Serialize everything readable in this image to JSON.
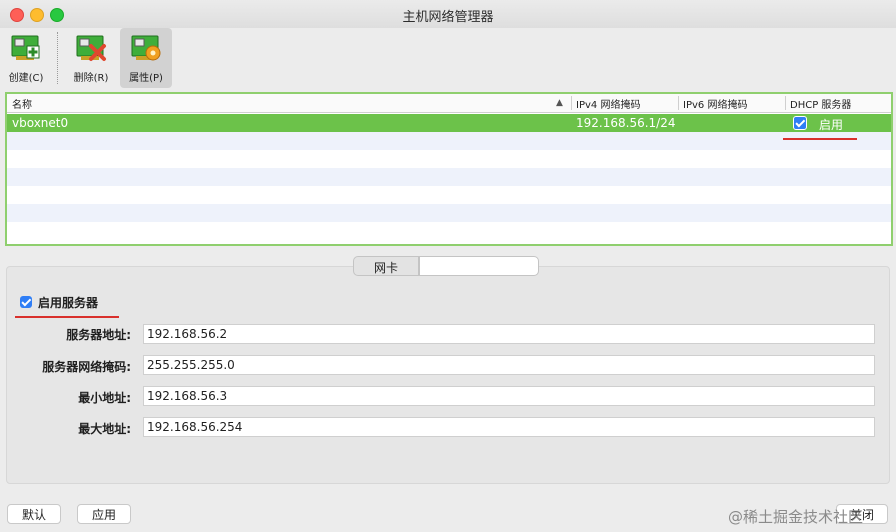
{
  "window": {
    "title": "主机网络管理器"
  },
  "toolbar": {
    "create_label": "创建(C)",
    "delete_label": "删除(R)",
    "properties_label": "属性(P)"
  },
  "table": {
    "columns": [
      "名称",
      "IPv4 网络掩码",
      "IPv6 网络掩码",
      "DHCP 服务器"
    ],
    "rows": [
      {
        "name": "vboxnet0",
        "ipv4": "192.168.56.1/24",
        "ipv6": "",
        "dhcp_label": "启用",
        "dhcp_checked": true
      }
    ]
  },
  "tabs": {
    "adapter_label": "网卡",
    "dhcp_label": ""
  },
  "dhcp": {
    "enable_label": "启用服务器",
    "enable_checked": true,
    "server_address_label": "服务器地址:",
    "server_address": "192.168.56.2",
    "server_mask_label": "服务器网络掩码:",
    "server_mask": "255.255.255.0",
    "lower_label": "最小地址:",
    "lower": "192.168.56.3",
    "upper_label": "最大地址:",
    "upper": "192.168.56.254"
  },
  "buttons": {
    "reset": "默认",
    "apply": "应用",
    "close": "关闭"
  },
  "watermark": "@稀土掘金技术社区",
  "colors": {
    "selection": "#6cc24a",
    "checkbox": "#2f7ef6",
    "annotation": "#d9302c"
  }
}
